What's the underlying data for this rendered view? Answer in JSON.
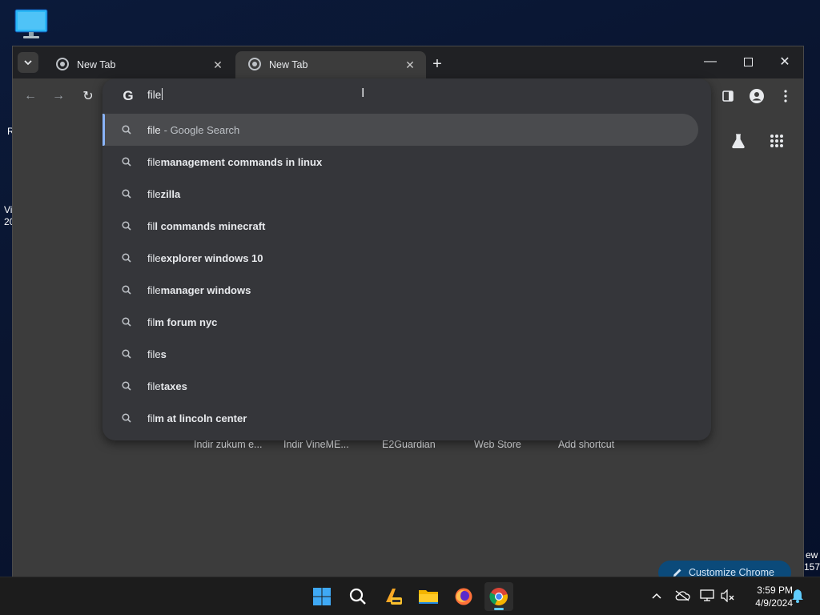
{
  "desktop": {
    "edge_texts": [
      "R",
      "Vi",
      "20",
      "ew",
      "157"
    ]
  },
  "browser": {
    "tabs": [
      {
        "label": "New Tab",
        "active": false
      },
      {
        "label": "New Tab",
        "active": true
      }
    ],
    "omnibox": {
      "typed": "file",
      "suggestions": [
        {
          "prefix": "file",
          "rest": "",
          "suffix": " - Google Search",
          "selected": true
        },
        {
          "prefix": "file",
          "rest": " management commands in linux",
          "suffix": "",
          "selected": false
        },
        {
          "prefix": "file",
          "rest": "zilla",
          "suffix": "",
          "selected": false
        },
        {
          "prefix": "fil",
          "rest": "l commands minecraft",
          "suffix": "",
          "selected": false
        },
        {
          "prefix": "file",
          "rest": " explorer windows 10",
          "suffix": "",
          "selected": false
        },
        {
          "prefix": "file",
          "rest": " manager windows",
          "suffix": "",
          "selected": false
        },
        {
          "prefix": "fil",
          "rest": "m forum nyc",
          "suffix": "",
          "selected": false
        },
        {
          "prefix": "file",
          "rest": "s",
          "suffix": "",
          "selected": false
        },
        {
          "prefix": "file",
          "rest": " taxes",
          "suffix": "",
          "selected": false
        },
        {
          "prefix": "fil",
          "rest": "m at lincoln center",
          "suffix": "",
          "selected": false
        }
      ]
    },
    "shortcuts": [
      "İndir zukum e...",
      "İndir VineME...",
      "E2Guardian",
      "Web Store",
      "Add shortcut"
    ],
    "customize_label": "Customize Chrome"
  },
  "taskbar": {
    "apps": [
      "start-icon",
      "search-icon",
      "app-pre-icon",
      "file-explorer-icon",
      "firefox-icon",
      "chrome-icon"
    ],
    "clock_time": "3:59 PM",
    "clock_date": "4/9/2024"
  },
  "colors": {
    "accent": "#8ab4f8",
    "window_bg": "#3c3c3c",
    "dropdown_bg": "#35363a",
    "taskbar_indicator": "#60cdff"
  }
}
